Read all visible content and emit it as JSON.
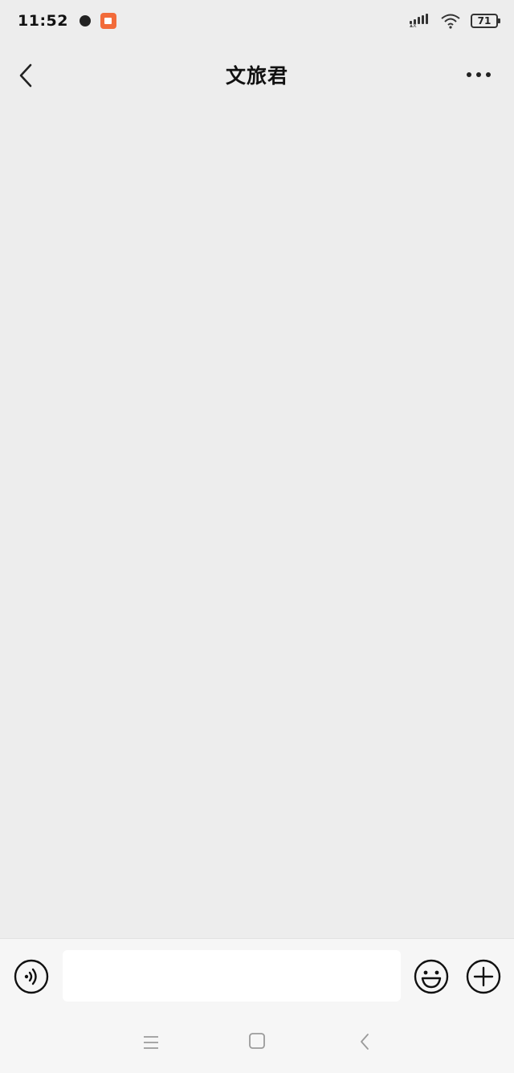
{
  "status_bar": {
    "time": "11:52",
    "battery_level": "71",
    "icons": [
      "recording-dot-icon",
      "app-notification-icon",
      "signal-icon",
      "wifi-icon",
      "battery-icon"
    ],
    "app_badge_color": "#f26b3a"
  },
  "header": {
    "title": "文旅君",
    "back_icon": "chevron-left-icon",
    "more_icon": "more-horizontal-icon"
  },
  "chat": {
    "background_color": "#ededed",
    "messages": []
  },
  "input_bar": {
    "message_value": "",
    "voice_icon": "voice-input-icon",
    "emoji_icon": "emoji-icon",
    "plus_icon": "plus-circle-icon"
  },
  "system_nav": {
    "icons": [
      "menu-icon",
      "home-icon",
      "back-icon"
    ]
  }
}
